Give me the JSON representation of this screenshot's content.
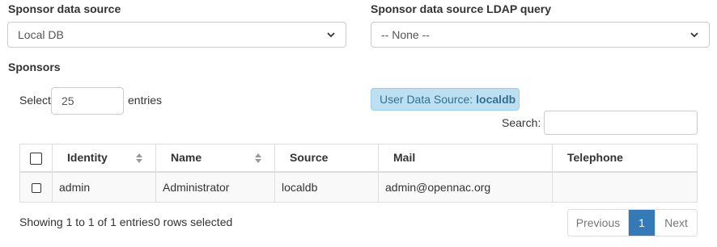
{
  "sponsor_source": {
    "label": "Sponsor data source",
    "selected": "Local DB"
  },
  "ldap_query": {
    "label": "Sponsor data source LDAP query",
    "selected": "-- None --"
  },
  "sponsors": {
    "heading": "Sponsors",
    "length": {
      "prefix": "Select",
      "value": "25",
      "suffix": "entries"
    },
    "info": {
      "icon": "info-circle-icon",
      "text": "User Data Source:",
      "value": "localdb"
    },
    "search": {
      "label": "Search:",
      "value": ""
    },
    "columns": [
      "Identity",
      "Name",
      "Source",
      "Mail",
      "Telephone"
    ],
    "rows": [
      {
        "identity": "admin",
        "name": "Administrator",
        "source": "localdb",
        "mail": "admin@opennac.org",
        "telephone": ""
      }
    ],
    "footer": {
      "showing": "Showing 1 to 1 of 1 entries",
      "selected": "0 rows selected"
    },
    "pagination": {
      "previous": "Previous",
      "current": "1",
      "next": "Next"
    }
  },
  "colors": {
    "accent": "#337ab7",
    "info_bg": "#bcdff1",
    "info_text": "#31708f"
  }
}
